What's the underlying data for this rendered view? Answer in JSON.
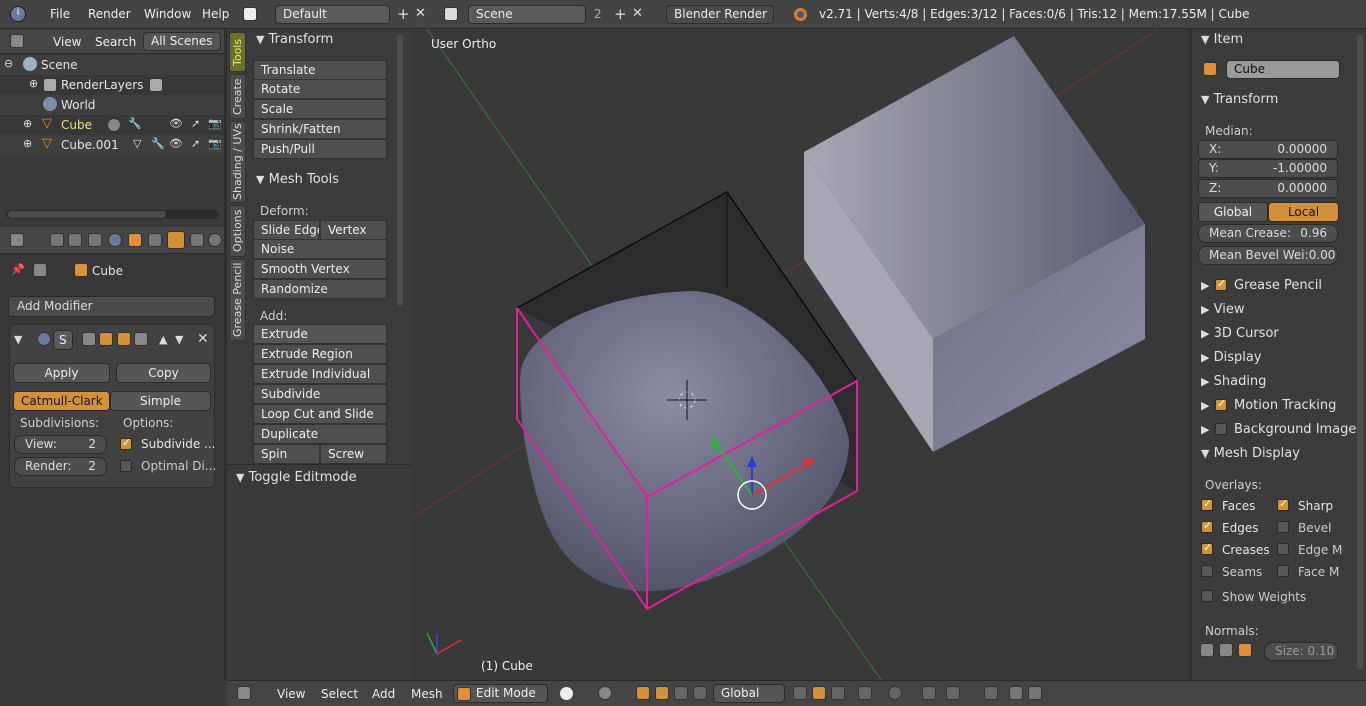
{
  "top": {
    "menus": [
      "File",
      "Render",
      "Window",
      "Help"
    ],
    "layout": "Default",
    "scene": "Scene",
    "scene_count": "2",
    "engine": "Blender Render",
    "stats": "v2.71 | Verts:4/8 | Edges:3/12 | Faces:0/6 | Tris:12 | Mem:17.55M | Cube"
  },
  "outliner": {
    "menus": [
      "View",
      "Search",
      "All Scenes"
    ],
    "items": [
      "Scene",
      "RenderLayers",
      "World",
      "Cube",
      "Cube.001"
    ]
  },
  "modifier": {
    "object": "Cube",
    "add": "Add Modifier",
    "short": "S",
    "apply": "Apply",
    "copy": "Copy",
    "catmull": "Catmull-Clark",
    "simple": "Simple",
    "subdivisions": "Subdivisions:",
    "options": "Options:",
    "view_label": "View:",
    "view_val": "2",
    "render_label": "Render:",
    "render_val": "2",
    "subdivide_uvs": "Subdivide ...",
    "optimal_display": "Optimal Di..."
  },
  "tabs": [
    "Tools",
    "Create",
    "Shading / UVs",
    "Options",
    "Grease Pencil"
  ],
  "tools": {
    "transform": "Transform",
    "transform_items": [
      "Translate",
      "Rotate",
      "Scale",
      "Shrink/Fatten",
      "Push/Pull"
    ],
    "mesh_tools": "Mesh Tools",
    "deform": "Deform:",
    "slide_edge": "Slide Edge",
    "vertex": "Vertex",
    "noise": "Noise",
    "smooth_vertex": "Smooth Vertex",
    "randomize": "Randomize",
    "add": "Add:",
    "extrude": "Extrude",
    "add_items": [
      "Extrude Region",
      "Extrude Individual",
      "Subdivide",
      "Loop Cut and Slide",
      "Duplicate"
    ],
    "spin": "Spin",
    "screw": "Screw",
    "toggle": "Toggle Editmode"
  },
  "viewport": {
    "view_name": "User Ortho",
    "object_label": "(1) Cube"
  },
  "props": {
    "item": "Item",
    "object_name": "Cube",
    "transform": "Transform",
    "median": "Median:",
    "x_label": "X:",
    "x": "0.00000",
    "y_label": "Y:",
    "y": "-1.00000",
    "z_label": "Z:",
    "z": "0.00000",
    "global": "Global",
    "local": "Local",
    "crease_label": "Mean Crease:",
    "crease": "0.96",
    "bevel_label": "Mean Bevel Wei:",
    "bevel": "0.00",
    "grease": "Grease Pencil",
    "view": "View",
    "cursor": "3D Cursor",
    "display": "Display",
    "shading": "Shading",
    "motion": "Motion Tracking",
    "background": "Background Images",
    "mesh_display": "Mesh Display",
    "overlays": "Overlays:",
    "faces": "Faces",
    "sharp": "Sharp",
    "edges": "Edges",
    "bevel2": "Bevel",
    "creases": "Creases",
    "edge_m": "Edge M",
    "seams": "Seams",
    "face_m": "Face M",
    "show_weights": "Show Weights",
    "normals": "Normals:",
    "size": "Size: 0.10"
  },
  "bottom": {
    "menus": [
      "View",
      "Select",
      "Add",
      "Mesh"
    ],
    "mode": "Edit Mode",
    "orientation": "Global"
  }
}
